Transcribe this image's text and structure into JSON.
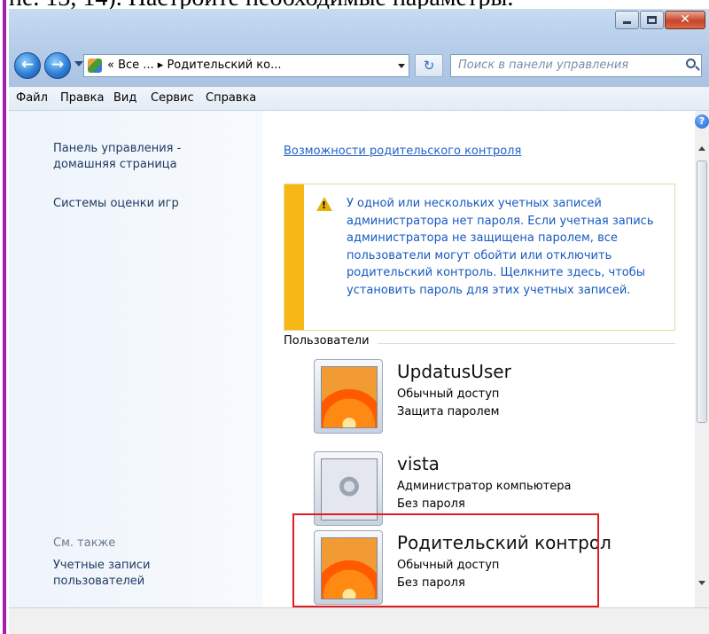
{
  "doc_text": "не. 13, 14). Настройте необходимые параметры.",
  "window": {
    "caption_buttons": {
      "minimize": "minimize",
      "maximize": "maximize",
      "close": "close"
    },
    "address": {
      "path": "« Все ... ▸ Родительский ко...",
      "icon": "control-panel-icon"
    },
    "search": {
      "placeholder": "Поиск в панели управления"
    },
    "menu": [
      "Файл",
      "Правка",
      "Вид",
      "Сервис",
      "Справка"
    ],
    "left_pane": {
      "home_link": "Панель управления - домашняя страница",
      "game_ratings": "Системы оценки игр",
      "see_also": "См. также",
      "user_accounts": "Учетные записи пользователей"
    },
    "main": {
      "header_link": "Возможности родительского контроля",
      "warning": "У одной или нескольких учетных записей администратора нет пароля. Если учетная запись администратора не защищена паролем, все пользователи могут обойти или отключить родительский контроль. Щелкните здесь, чтобы установить пароль для этих учетных записей.",
      "group_label": "Пользователи",
      "users": [
        {
          "name": "UpdatusUser",
          "line1": "Обычный доступ",
          "line2": "Защита паролем"
        },
        {
          "name": "vista",
          "line1": "Администратор компьютера",
          "line2": "Без пароля"
        },
        {
          "name": "Родительский контрол",
          "line1": "Обычный доступ",
          "line2": "Без пароля"
        }
      ]
    },
    "help": "?",
    "colors": {
      "accent": "#f7b815",
      "link": "#2063c9",
      "highlight": "#e21b24"
    }
  }
}
